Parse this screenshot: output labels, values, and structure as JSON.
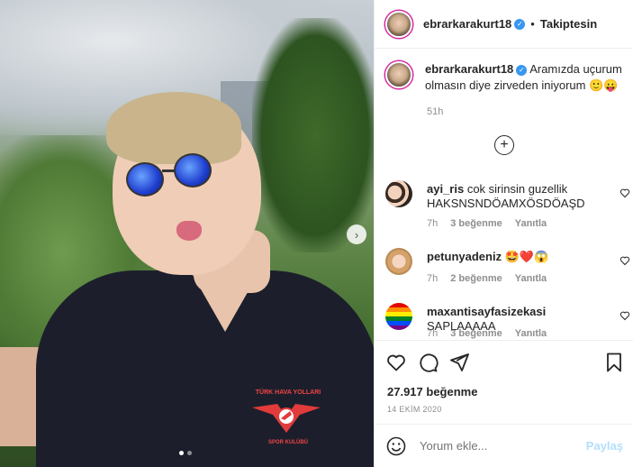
{
  "header": {
    "username": "ebrarkarakurt18",
    "separator": "•",
    "follow_label": "Takiptesin"
  },
  "caption": {
    "username": "ebrarkarakurt18",
    "text": "Aramızda uçurum olmasın diye zirveden iniyorum 🙂😛",
    "time": "51h"
  },
  "load_more_icon": "plus-circle-icon",
  "comments": [
    {
      "username": "ayi_ris",
      "text": "cok sirinsin guzellik HAKSNSNDÖAMXÖSDÖAŞD",
      "time": "7h",
      "likes": "3 beğenme",
      "reply": "Yanıtla"
    },
    {
      "username": "petunyadeniz",
      "text": "🤩❤️😱",
      "time": "7h",
      "likes": "2 beğenme",
      "reply": "Yanıtla"
    },
    {
      "username": "maxantisayfasizekasi",
      "text": "SAPLAAAAA",
      "time": "7h",
      "likes": "3 beğenme",
      "reply": "Yanıtla"
    }
  ],
  "actions": {
    "like_icon": "heart-icon",
    "comment_icon": "comment-icon",
    "share_icon": "share-icon",
    "save_icon": "bookmark-icon"
  },
  "likes_label": "27.917 beğenme",
  "date_label": "14 EKİM 2020",
  "add_comment": {
    "placeholder": "Yorum ekle...",
    "post_label": "Paylaş",
    "emoji_icon": "smiley-icon"
  },
  "photo": {
    "logo_text": "TÜRK HAVA YOLLARI",
    "logo_sub": "SPOR KULÜBÜ",
    "carousel_next_icon": "chevron-right-icon",
    "carousel_pages": 2,
    "carousel_active": 1
  },
  "colors": {
    "accent": "#3897f0",
    "post_disabled": "#b2dffc",
    "meta_gray": "#8e8e8e",
    "text": "#262626"
  }
}
